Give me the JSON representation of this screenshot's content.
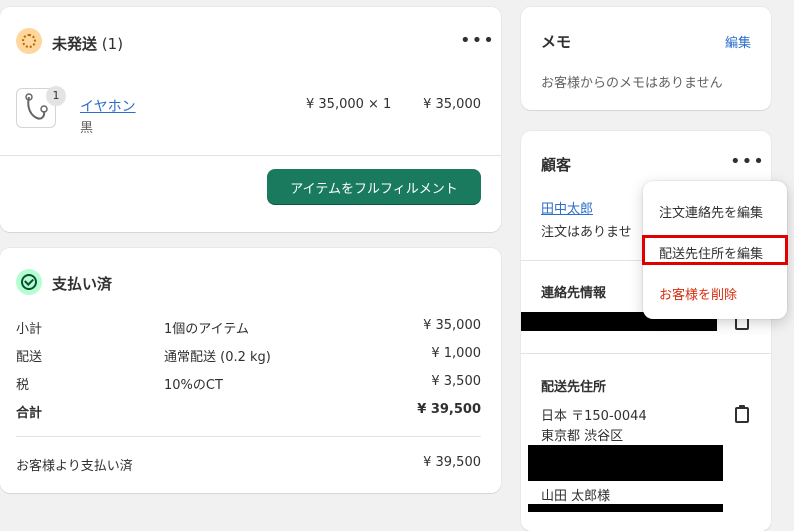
{
  "unfulfilled": {
    "title": "未発送",
    "count": "(1)",
    "product": {
      "name": "イヤホン",
      "variant": "黒",
      "quantity": "1",
      "unit_price": "¥ 35,000 × 1",
      "total": "¥ 35,000"
    },
    "fulfill_button": "アイテムをフルフィルメント"
  },
  "paid": {
    "title": "支払い済",
    "rows": [
      {
        "label": "小計",
        "detail": "1個のアイテム",
        "amount": "¥ 35,000"
      },
      {
        "label": "配送",
        "detail": "通常配送 (0.2 kg)",
        "amount": "¥ 1,000"
      },
      {
        "label": "税",
        "detail": "10%のCT",
        "amount": "¥ 3,500"
      },
      {
        "label": "合計",
        "detail": "",
        "amount": "¥ 39,500"
      }
    ],
    "paid_by_customer_label": "お客様より支払い済",
    "paid_by_customer_amount": "¥ 39,500"
  },
  "memo": {
    "title": "メモ",
    "edit_label": "編集",
    "empty_text": "お客様からのメモはありません"
  },
  "customer": {
    "title": "顧客",
    "name": "田中太郎",
    "orders_text": "注文はありませ",
    "contact_title": "連絡先情報",
    "shipping_title": "配送先住所",
    "address_line1": "日本 〒150-0044",
    "address_line2": "東京都 渋谷区",
    "recipient": "山田 太郎様"
  },
  "menu": {
    "items": [
      "注文連絡先を編集",
      "配送先住所を編集",
      "お客様を削除"
    ],
    "danger_color": "#d72c0d",
    "highlight_color": "#e00000"
  },
  "colors": {
    "primary": "#1a7a5e",
    "link": "#2c6ecb",
    "background": "#f1f1f1"
  }
}
